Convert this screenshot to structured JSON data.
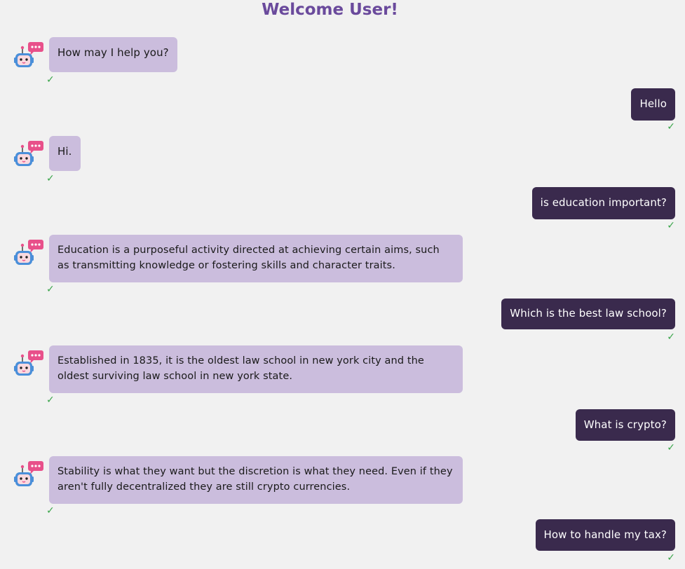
{
  "header": {
    "title": "Welcome User!"
  },
  "status": {
    "delivered_mark": "✓"
  },
  "colors": {
    "title": "#6a4a9c",
    "bot_bubble": "#cbbddd",
    "user_bubble": "#3a2a4d",
    "checkmark": "#3aa54a",
    "background": "#f1f1f1"
  },
  "messages": [
    {
      "sender": "bot",
      "text": "How may I help you?",
      "avatar_icon": "robot-chat-icon"
    },
    {
      "sender": "user",
      "text": "Hello"
    },
    {
      "sender": "bot",
      "text": "Hi.",
      "avatar_icon": "robot-chat-icon"
    },
    {
      "sender": "user",
      "text": "is education important?"
    },
    {
      "sender": "bot",
      "text": "Education is a purposeful activity directed at achieving certain aims, such as transmitting knowledge or fostering skills and character traits.",
      "avatar_icon": "robot-chat-icon"
    },
    {
      "sender": "user",
      "text": "Which is the best law school?"
    },
    {
      "sender": "bot",
      "text": "Established in 1835, it is the oldest law school in new york city and the oldest surviving law school in new york state.",
      "avatar_icon": "robot-chat-icon"
    },
    {
      "sender": "user",
      "text": "What is crypto?"
    },
    {
      "sender": "bot",
      "text": "Stability is what they want but the discretion is what they need. Even if they aren't fully decentralized they are still crypto currencies.",
      "avatar_icon": "robot-chat-icon"
    },
    {
      "sender": "user",
      "text": "How to handle my tax?"
    }
  ]
}
